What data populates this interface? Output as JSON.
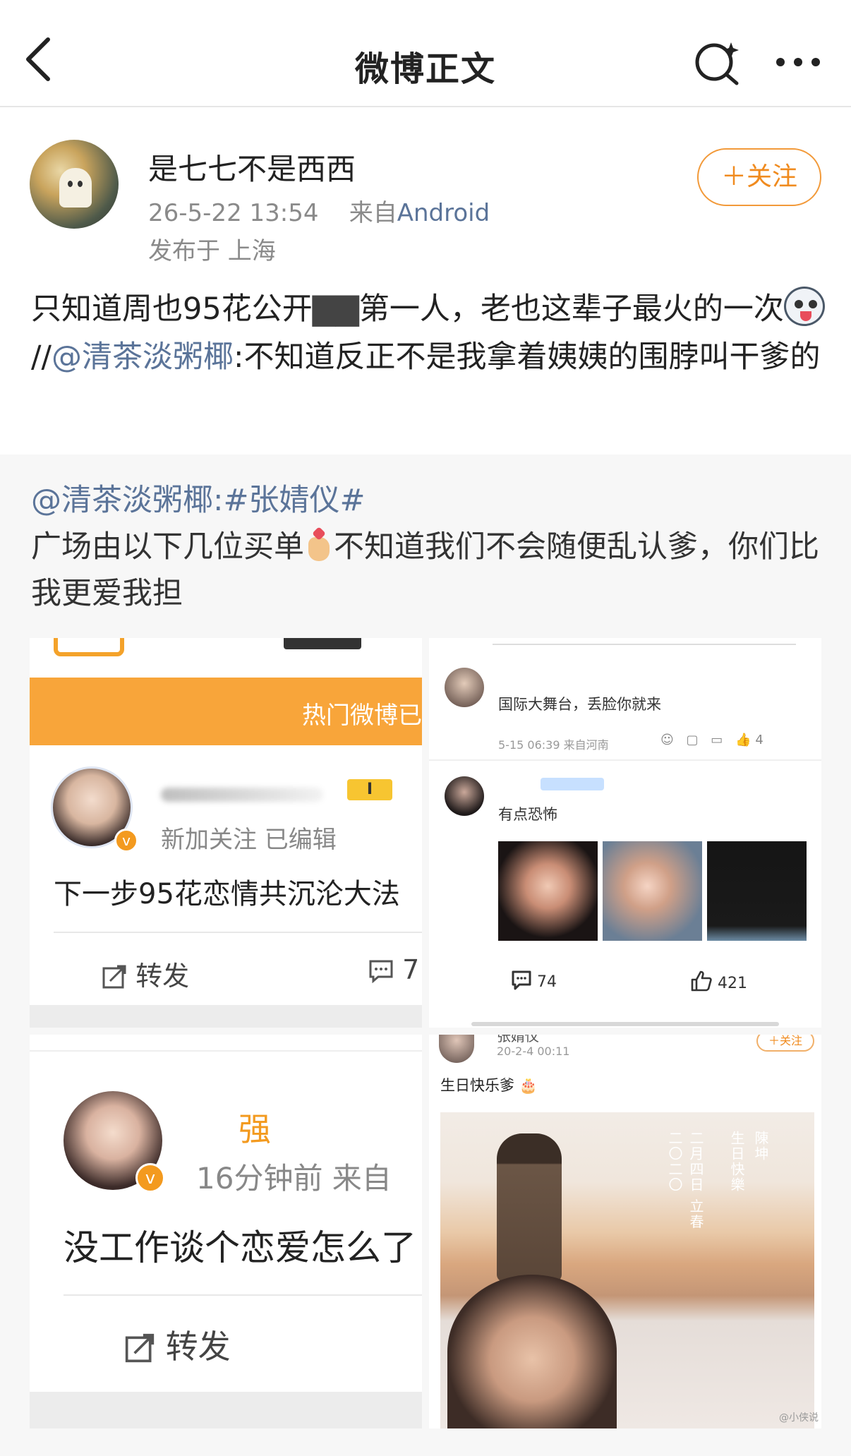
{
  "nav": {
    "title": "微博正文",
    "icons": [
      "back-arrow-icon",
      "search-icon",
      "more-icon"
    ]
  },
  "author": {
    "name": "是七七不是西西",
    "time": "26-5-22 13:54",
    "source_prefix": "来自",
    "source": "Android",
    "location": "发布于 上海",
    "follow_label": "＋关注"
  },
  "post": {
    "text_before": "只知道周也95花公开",
    "text_masked": "▇▇",
    "text_after": "第一人，老也这辈子最火的一次",
    "text_sep": "//",
    "mention": "@清茶淡粥椰",
    "text_quote": ":不知道反正不是我拿着姨姨的围脖叫干爹的"
  },
  "retweet": {
    "mention": "@清茶淡粥椰",
    "topic": ":#张婧仪#",
    "text1": "广场由以下几位买单",
    "text2": "不知道我们不会随便乱认爹，你们比我更爱我担"
  },
  "images": {
    "tile1": {
      "header_text": "热门微博已",
      "level_badge": "I",
      "meta": "新加关注  已编辑",
      "text": "下一步95花恋情共沉沦大法",
      "forward_label": "转发",
      "comment_count": "7"
    },
    "tile2": {
      "comment1_text": "国际大舞台，丢脸你就来",
      "comment1_meta": "5-15 06:39  来自河南",
      "comment1_like": "4",
      "comment2_text": "有点恐怖",
      "comments_count": "74",
      "likes_count": "421"
    },
    "tile3": {
      "name": "强",
      "meta": "16分钟前  来自",
      "text": "没工作谈个恋爱怎么了",
      "forward_label": "转发"
    },
    "tile4": {
      "name": "张婧仪",
      "date": "20-2-4 00:11",
      "follow_label": "＋关注",
      "text": "生日快乐爹",
      "vertical_1": "陳坤",
      "vertical_2": "生日快樂",
      "vertical_3": "二月四日 立春",
      "vertical_4": "二〇二〇",
      "watermark": "@小侠说"
    }
  }
}
